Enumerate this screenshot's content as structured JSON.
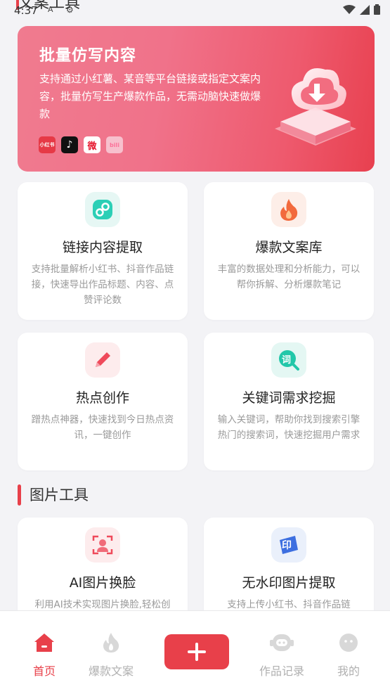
{
  "status_bar": {
    "time": "4:37",
    "notif_a": "A",
    "notif_b": "⚙"
  },
  "top_section": {
    "title": "文案工具"
  },
  "banner": {
    "title": "批量仿写内容",
    "description": "支持通过小红薯、某音等平台链接或指定文案内容，批量仿写生产爆款作品，无需动脑快速做爆款",
    "platform_logos": [
      {
        "name": "xiaohongshu",
        "text": "小红书"
      },
      {
        "name": "douyin",
        "text": "♪"
      },
      {
        "name": "weibo",
        "text": "微"
      },
      {
        "name": "bilibili",
        "text": "bili"
      }
    ]
  },
  "text_tools": [
    {
      "title": "链接内容提取",
      "desc": "支持批量解析小红书、抖音作品链接，快速导出作品标题、内容、点赞评论数",
      "icon": "link-icon"
    },
    {
      "title": "爆款文案库",
      "desc": "丰富的数据处理和分析能力，可以帮你拆解、分析爆款笔记",
      "icon": "flame-icon"
    },
    {
      "title": "热点创作",
      "desc": "蹭热点神器，快速找到今日热点资讯，一键创作",
      "icon": "pencil-icon"
    },
    {
      "title": "关键词需求挖掘",
      "desc": "输入关键词，帮助你找到搜索引擎热门的搜索词，快速挖掘用户需求",
      "icon": "keyword-search-icon",
      "icon_char": "词"
    }
  ],
  "image_section": {
    "title": "图片工具"
  },
  "image_tools": [
    {
      "title": "AI图片换脸",
      "desc": "利用AI技术实现图片换脸,轻松创",
      "icon": "face-scan-icon"
    },
    {
      "title": "无水印图片提取",
      "desc": "支持上传小红书、抖音作品链",
      "icon": "stamp-icon",
      "icon_char": "印"
    }
  ],
  "tabbar": {
    "items": [
      {
        "label": "首页",
        "icon": "home-icon",
        "active": true
      },
      {
        "label": "爆款文案",
        "icon": "flame-icon",
        "active": false
      },
      {
        "label": "",
        "icon": "plus-icon",
        "active": false
      },
      {
        "label": "作品记录",
        "icon": "robot-icon",
        "active": false
      },
      {
        "label": "我的",
        "icon": "user-face-icon",
        "active": false
      }
    ]
  },
  "colors": {
    "accent": "#e8404a",
    "banner_start": "#f07b8f",
    "banner_end": "#e8404f"
  }
}
